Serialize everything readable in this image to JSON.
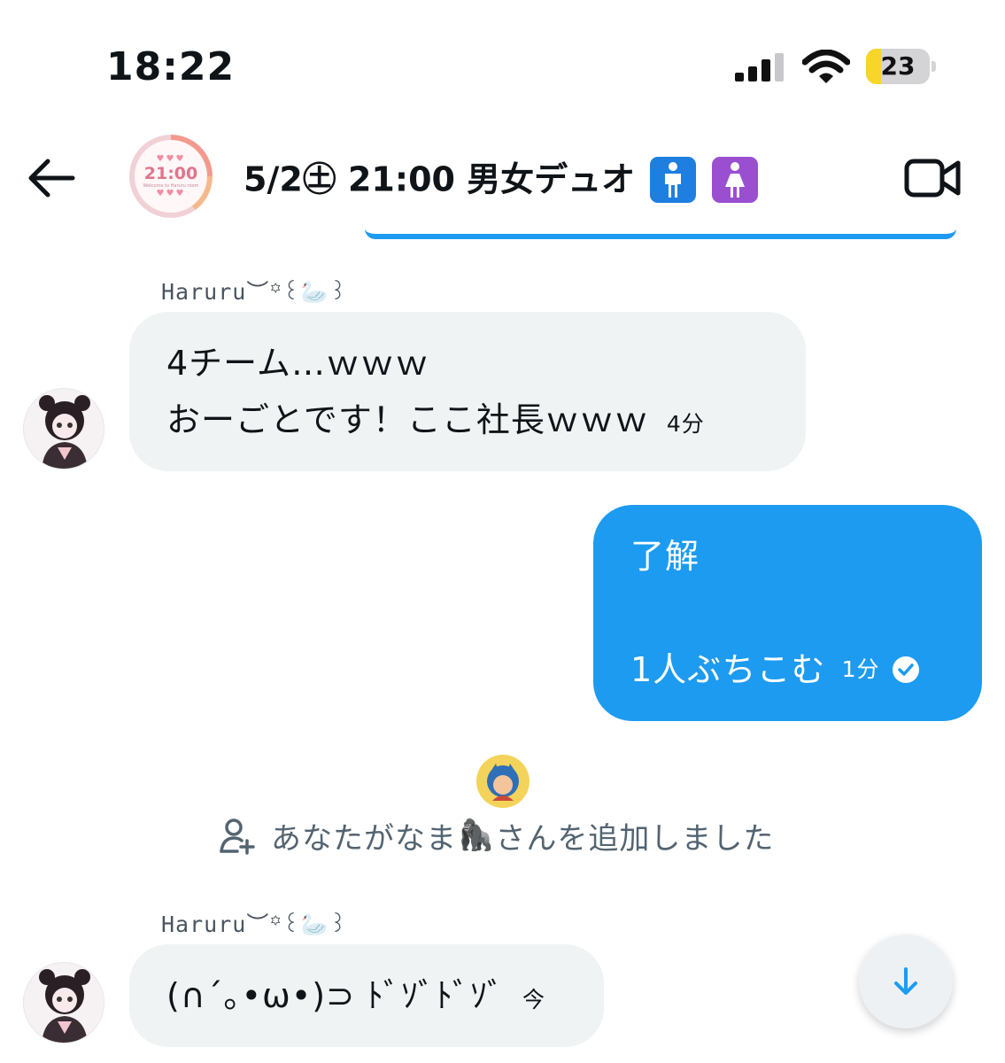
{
  "status_bar": {
    "time": "18:22",
    "battery_level": "23",
    "battery_fraction": 0.23,
    "battery_fill_color": "#f8d52a"
  },
  "header": {
    "back_icon": "arrow-left-icon",
    "group_avatar": {
      "time_text": "21:00",
      "sub_text": "Welcome to Haruru room"
    },
    "title": "5/2㊏ 21:00 男女デュオ",
    "title_icons": [
      "man-symbol-icon",
      "woman-symbol-icon"
    ],
    "video_icon": "video-camera-icon"
  },
  "messages": [
    {
      "direction": "incoming",
      "sender": "Haruru",
      "sender_decoration": "︶꙳꒰",
      "sender_emoji": "🦢",
      "sender_tail": "꒱",
      "lines": [
        "4チーム…ｗｗｗ",
        "おーごとです！ここ社長ｗｗｗ"
      ],
      "time": "4分"
    },
    {
      "direction": "outgoing",
      "lines": [
        "了解",
        "",
        "1人ぶちこむ"
      ],
      "time": "1分",
      "status_icon": "read-check-icon"
    },
    {
      "direction": "incoming",
      "sender": "Haruru",
      "sender_decoration": "︶꙳꒰",
      "sender_emoji": "🦢",
      "sender_tail": "꒱",
      "lines": [
        "(∩´｡•ω•)⊃ ﾄﾞｿﾞﾄﾞｿﾞ"
      ],
      "time": "今"
    }
  ],
  "system_event": {
    "icon": "add-user-icon",
    "text_before": "あなたがなま",
    "emoji": "🦍",
    "text_after": "さんを追加しました"
  },
  "scroll_button": {
    "icon": "arrow-down-icon"
  },
  "colors": {
    "accent": "#1d9bf0",
    "incoming_bubble": "#eff3f4",
    "secondary_text": "#536471"
  }
}
